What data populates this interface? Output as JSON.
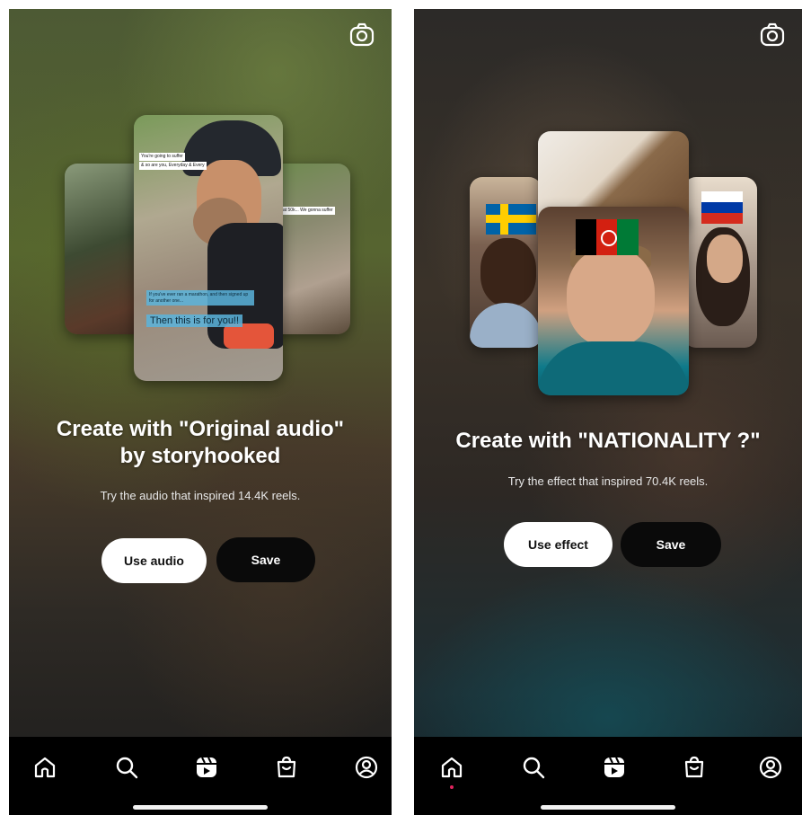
{
  "screens": [
    {
      "title": "Create with \"Original audio\" by storyhooked",
      "subtitle": "Try the audio that inspired 14.4K reels.",
      "primary_button": "Use audio",
      "secondary_button": "Save",
      "card_captions": {
        "front_top_1": "You're going to suffer",
        "front_top_2": "& so are you, Everyday & Every",
        "front_box": "If you've ever ran a marathon, and then signed up for another one...",
        "front_big": "Then this is for you!!",
        "right_tag": "A New England fat 50k... We gonna suffer"
      }
    },
    {
      "title": "Create with \"NATIONALITY ?\"",
      "subtitle": "Try the effect that inspired 70.4K reels.",
      "primary_button": "Use effect",
      "secondary_button": "Save"
    }
  ],
  "nav_items": [
    {
      "icon": "home-icon"
    },
    {
      "icon": "search-icon"
    },
    {
      "icon": "reels-icon"
    },
    {
      "icon": "shop-icon"
    },
    {
      "icon": "profile-icon"
    }
  ],
  "top_action": {
    "icon": "camera-icon"
  },
  "colors": {
    "nav_background": "#000000",
    "primary_button_bg": "#ffffff",
    "secondary_button_bg": "#0a0a0a",
    "active_dot": "#e0245e"
  }
}
